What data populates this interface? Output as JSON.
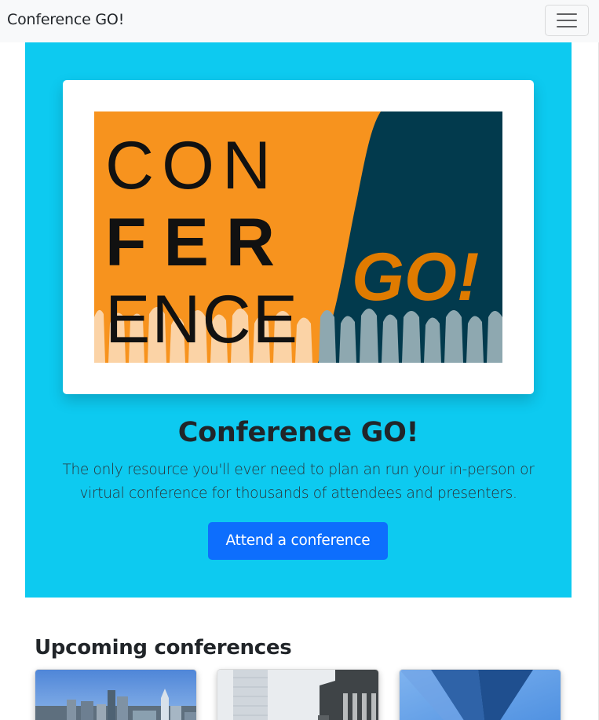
{
  "navbar": {
    "brand": "Conference GO!",
    "toggler_icon": "hamburger-menu-icon"
  },
  "hero": {
    "background_color": "#0dcaf0",
    "logo": {
      "alt": "Conference GO! logo",
      "word_line1": "CON",
      "word_line2": "FER",
      "word_line3": "ENCE",
      "go_text": "GO!",
      "colors": {
        "orange": "#f7931e",
        "navy": "#023a4d",
        "go": "#e07b00"
      }
    },
    "title": "Conference GO!",
    "lead": "The only resource you'll ever need to plan an run your in-person or virtual conference for thousands of attendees and presenters.",
    "cta_label": "Attend a conference",
    "cta_color": "#0d6efd"
  },
  "upcoming": {
    "heading": "Upcoming conferences",
    "cards": [
      {
        "image": "city-skyline-photo"
      },
      {
        "image": "tower-buildings-photo"
      },
      {
        "image": "glass-skyscraper-photo"
      }
    ]
  }
}
